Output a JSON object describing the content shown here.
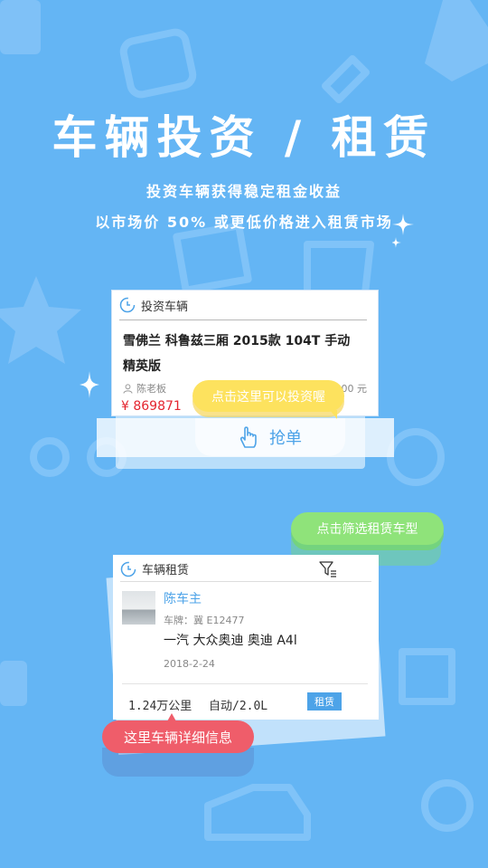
{
  "hero": {
    "title": "车辆投资 / 租赁",
    "subtitle_line1": "投资车辆获得稳定租金收益",
    "subtitle_line2": "以市场价 50% 或更低价格进入租赁市场"
  },
  "invest_card": {
    "header": "投资车辆",
    "car_title": "雪佛兰 科鲁兹三厢 2015款 104T 手动精英版",
    "owner": "陈老板",
    "amount_right": "000 元",
    "price": "¥ 869871",
    "grab_label": "抢单",
    "tooltip": "点击这里可以投资喔"
  },
  "filter_tooltip": "点击筛选租赁车型",
  "rental_card": {
    "header": "车辆租赁",
    "owner_name": "陈车主",
    "plate": "车牌：冀 E12477",
    "model": "一汽 大众奥迪 奥迪 A4l",
    "date": "2018-2-24",
    "mileage": "1.24万公里",
    "transmission": "自动/2.0L",
    "rent_button": "租赁",
    "tooltip": "这里车辆详细信息"
  },
  "colors": {
    "background": "#64b5f4",
    "accent_blue": "#4da3e8",
    "price_red": "#e4252f",
    "tooltip_yellow": "#fde25e",
    "tooltip_green": "#8fe37a",
    "tooltip_red": "#ef5d6a"
  },
  "icons": {
    "sparkles": "sparkle-icon",
    "header_icon": "clock-icon",
    "grab_icon": "hand-pointer-icon",
    "filter_icon": "filter-icon",
    "owner_icon": "person-icon"
  }
}
